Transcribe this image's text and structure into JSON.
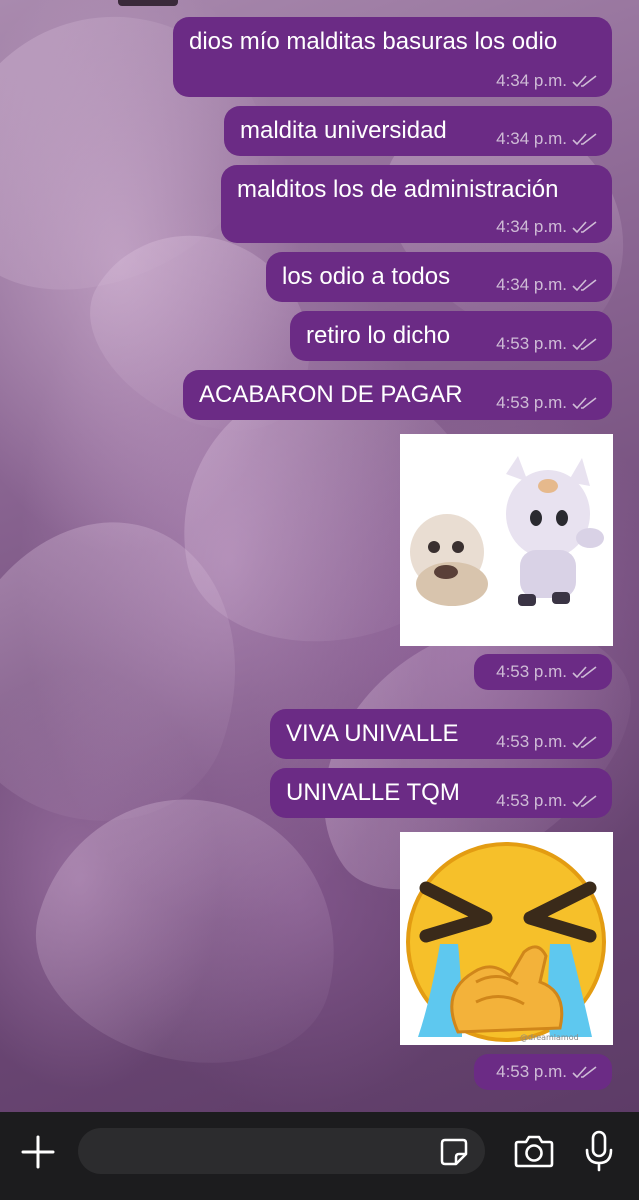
{
  "messages": [
    {
      "text": "dios mío malditas basuras los odio",
      "time": "4:34 p.m."
    },
    {
      "text": "maldita universidad",
      "time": "4:34 p.m."
    },
    {
      "text": "malditos los de administración",
      "time": "4:34 p.m."
    },
    {
      "text": "los odio a todos",
      "time": "4:34 p.m."
    },
    {
      "text": "retiro lo dicho",
      "time": "4:53 p.m."
    },
    {
      "text": "ACABARON DE PAGAR",
      "time": "4:53 p.m."
    },
    {
      "sticker": "two-cartoon-creatures-sticker",
      "time": "4:53 p.m."
    },
    {
      "text": "VIVA UNIVALLE",
      "time": "4:53 p.m."
    },
    {
      "text": "UNIVALLE TQM",
      "time": "4:53 p.m."
    },
    {
      "sticker": "crying-laughing-emoji-sticker",
      "time": "4:53 p.m."
    }
  ],
  "sticker2_caption": "@dreamlamod",
  "colors": {
    "bubble": "#6b2b85",
    "meta": "#cfbcd6",
    "bar": "#1c1c1e"
  },
  "input_bar": {
    "icons": [
      "plus-icon",
      "sticker-icon",
      "camera-icon",
      "microphone-icon"
    ]
  }
}
